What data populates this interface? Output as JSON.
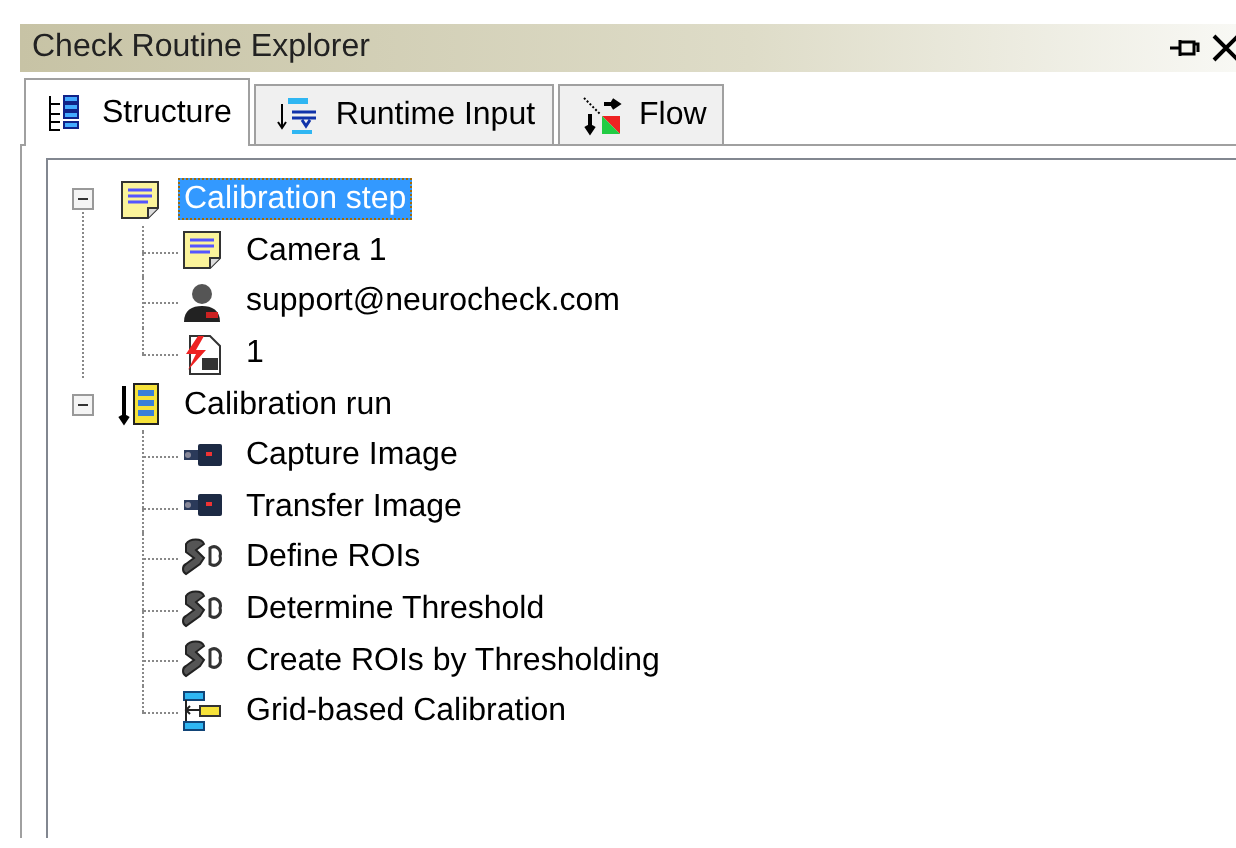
{
  "window": {
    "title": "Check Routine Explorer"
  },
  "tabs": [
    {
      "label": "Structure",
      "kind": "structure",
      "selected": true
    },
    {
      "label": "Runtime Input",
      "kind": "input",
      "selected": false
    },
    {
      "label": "Flow",
      "kind": "flow",
      "selected": false
    }
  ],
  "tree": [
    {
      "label": "Calibration step",
      "kind": "note",
      "expanded": true,
      "selected": true,
      "children": [
        {
          "label": "Camera 1",
          "kind": "note",
          "selected": false
        },
        {
          "label": "support@neurocheck.com",
          "kind": "person",
          "selected": false
        },
        {
          "label": "1",
          "kind": "id",
          "selected": false
        }
      ]
    },
    {
      "label": "Calibration run",
      "kind": "run",
      "expanded": true,
      "selected": false,
      "children": [
        {
          "label": "Capture Image",
          "kind": "camera",
          "selected": false
        },
        {
          "label": "Transfer Image",
          "kind": "camera",
          "selected": false
        },
        {
          "label": "Define ROIs",
          "kind": "shapes",
          "selected": false
        },
        {
          "label": "Determine Threshold",
          "kind": "shapes",
          "selected": false
        },
        {
          "label": "Create ROIs by Thresholding",
          "kind": "shapes",
          "selected": false
        },
        {
          "label": "Grid-based Calibration",
          "kind": "grid",
          "selected": false
        }
      ]
    }
  ]
}
